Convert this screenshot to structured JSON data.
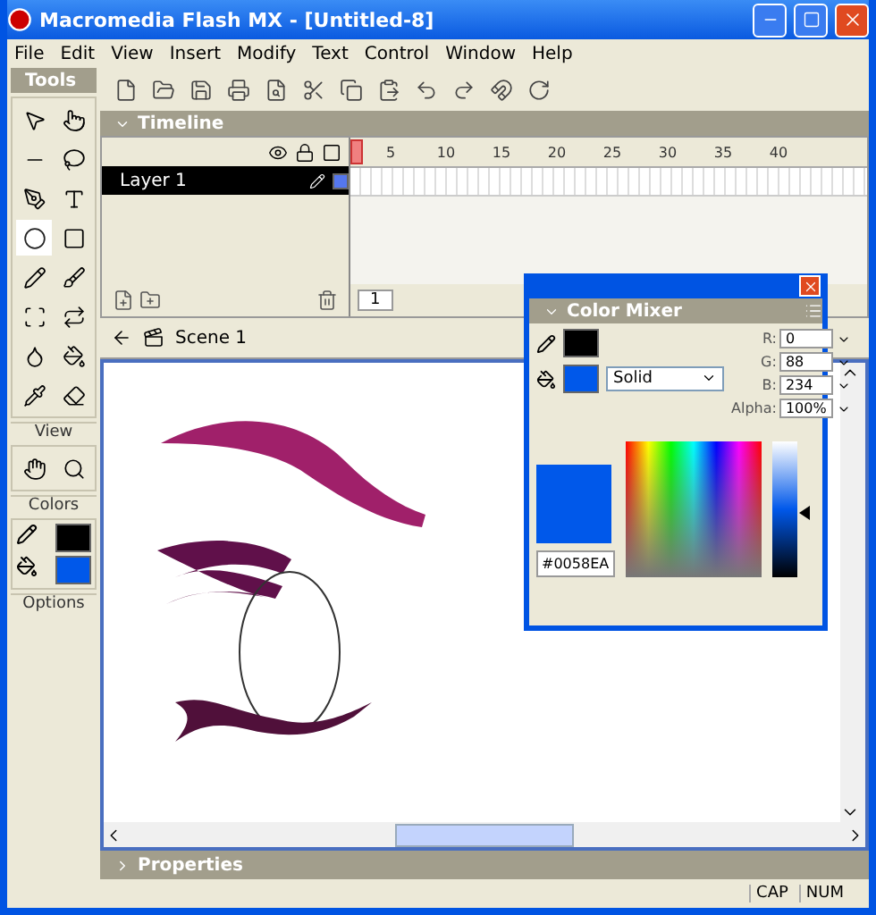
{
  "window": {
    "title": "Macromedia Flash MX - [Untitled-8]"
  },
  "menu": [
    "File",
    "Edit",
    "View",
    "Insert",
    "Modify",
    "Text",
    "Control",
    "Window",
    "Help"
  ],
  "tools": {
    "title": "Tools",
    "sections": [
      "View",
      "Colors",
      "Options"
    ]
  },
  "timeline": {
    "title": "Timeline",
    "expanded": true,
    "frame_labels": [
      "5",
      "10",
      "15",
      "20",
      "25",
      "30",
      "35",
      "40"
    ],
    "current_frame": "1",
    "layers": [
      {
        "name": "Layer 1",
        "selected": true
      }
    ]
  },
  "scene": {
    "name": "Scene 1"
  },
  "color_mixer": {
    "title": "Color Mixer",
    "fill_type": "Solid",
    "channels": [
      {
        "label": "R:",
        "value": "0"
      },
      {
        "label": "G:",
        "value": "88"
      },
      {
        "label": "B:",
        "value": "234"
      },
      {
        "label": "Alpha:",
        "value": "100%"
      }
    ],
    "hex": "#0058EA",
    "brightness": {
      "level": 0.47
    }
  },
  "properties": {
    "title": "Properties",
    "expanded": false
  },
  "status_bar": [
    "CAP",
    "NUM"
  ]
}
